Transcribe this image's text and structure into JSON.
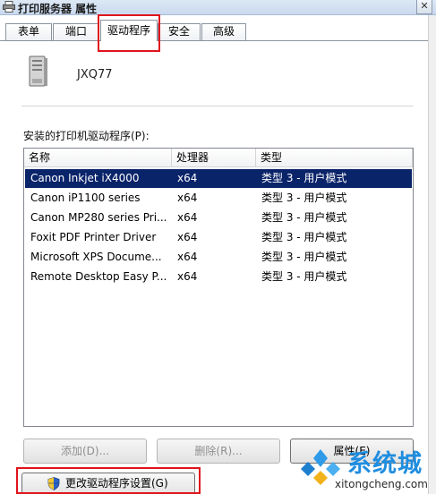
{
  "window": {
    "title": "打印服务器 属性",
    "close_glyph": "✕"
  },
  "tabs": [
    {
      "label": "表单"
    },
    {
      "label": "端口"
    },
    {
      "label": "驱动程序"
    },
    {
      "label": "安全"
    },
    {
      "label": "高级"
    }
  ],
  "active_tab": "驱动程序",
  "server": {
    "icon": "server-icon",
    "name": "JXQ77"
  },
  "drivers_label": "安装的打印机驱动程序(P):",
  "list": {
    "columns": [
      "名称",
      "处理器",
      "类型"
    ],
    "rows": [
      {
        "name": "Canon Inkjet iX4000",
        "processor": "x64",
        "type": "类型 3 - 用户模式",
        "selected": true
      },
      {
        "name": "Canon iP1100 series",
        "processor": "x64",
        "type": "类型 3 - 用户模式"
      },
      {
        "name": "Canon MP280 series Pri...",
        "processor": "x64",
        "type": "类型 3 - 用户模式"
      },
      {
        "name": "Foxit PDF Printer Driver",
        "processor": "x64",
        "type": "类型 3 - 用户模式"
      },
      {
        "name": "Microsoft XPS Docume...",
        "processor": "x64",
        "type": "类型 3 - 用户模式"
      },
      {
        "name": "Remote Desktop Easy P...",
        "processor": "x64",
        "type": "类型 3 - 用户模式"
      }
    ]
  },
  "buttons": {
    "add": "添加(D)...",
    "remove": "删除(R)...",
    "properties": "属性(E)"
  },
  "change_settings": {
    "icon": "uac-shield-icon",
    "label": "更改驱动程序设置(G)"
  },
  "watermark": {
    "brand": "系统城",
    "url": "xitongcheng.com"
  },
  "colors": {
    "selection": "#0a246a",
    "highlight_box": "#e0141b",
    "watermark": "#1f8de0"
  }
}
